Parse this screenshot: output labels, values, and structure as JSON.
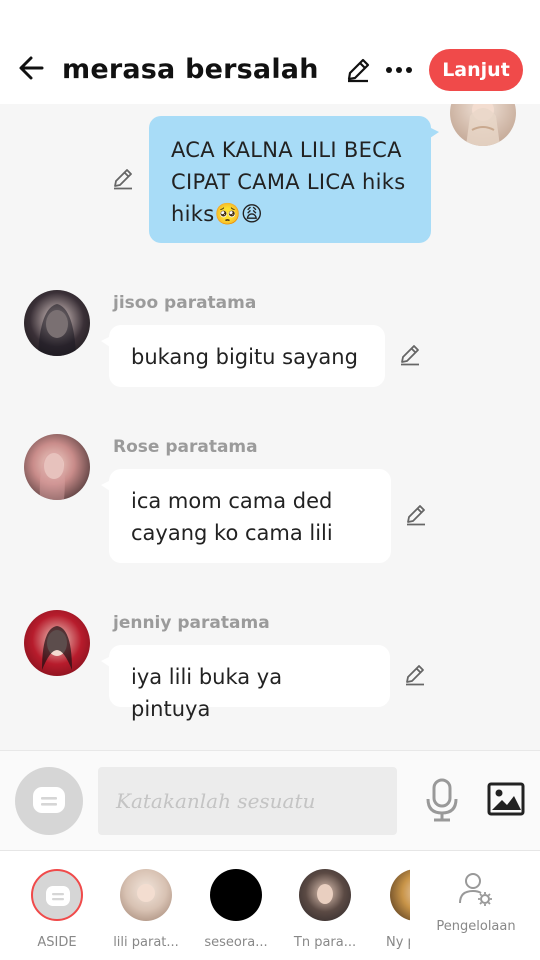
{
  "header": {
    "title": "merasa bersalah",
    "action_button": "Lanjut"
  },
  "chat": {
    "messages": [
      {
        "side": "right",
        "sender": "",
        "text": "ACA KALNA LILI BECA CIPAT CAMA LICA hiks hiks🥺😩"
      },
      {
        "side": "left",
        "sender": "jisoo paratama",
        "text": "bukang bigitu sayang"
      },
      {
        "side": "left",
        "sender": "Rose paratama",
        "text": "ica mom cama ded cayang ko cama lili"
      },
      {
        "side": "left",
        "sender": "jenniy paratama",
        "text": "iya lili buka ya pintuya"
      }
    ]
  },
  "composer": {
    "placeholder": "Katakanlah sesuatu"
  },
  "characters": [
    {
      "label": "ASIDE"
    },
    {
      "label": "lili parat..."
    },
    {
      "label": "seseora..."
    },
    {
      "label": "Tn para..."
    },
    {
      "label": "Ny p"
    }
  ],
  "management": {
    "label": "Pengelolaan"
  },
  "colors": {
    "accent": "#f04a4a",
    "own_bubble": "#a8dcf7",
    "other_bubble": "#ffffff",
    "background": "#f6f6f6"
  }
}
